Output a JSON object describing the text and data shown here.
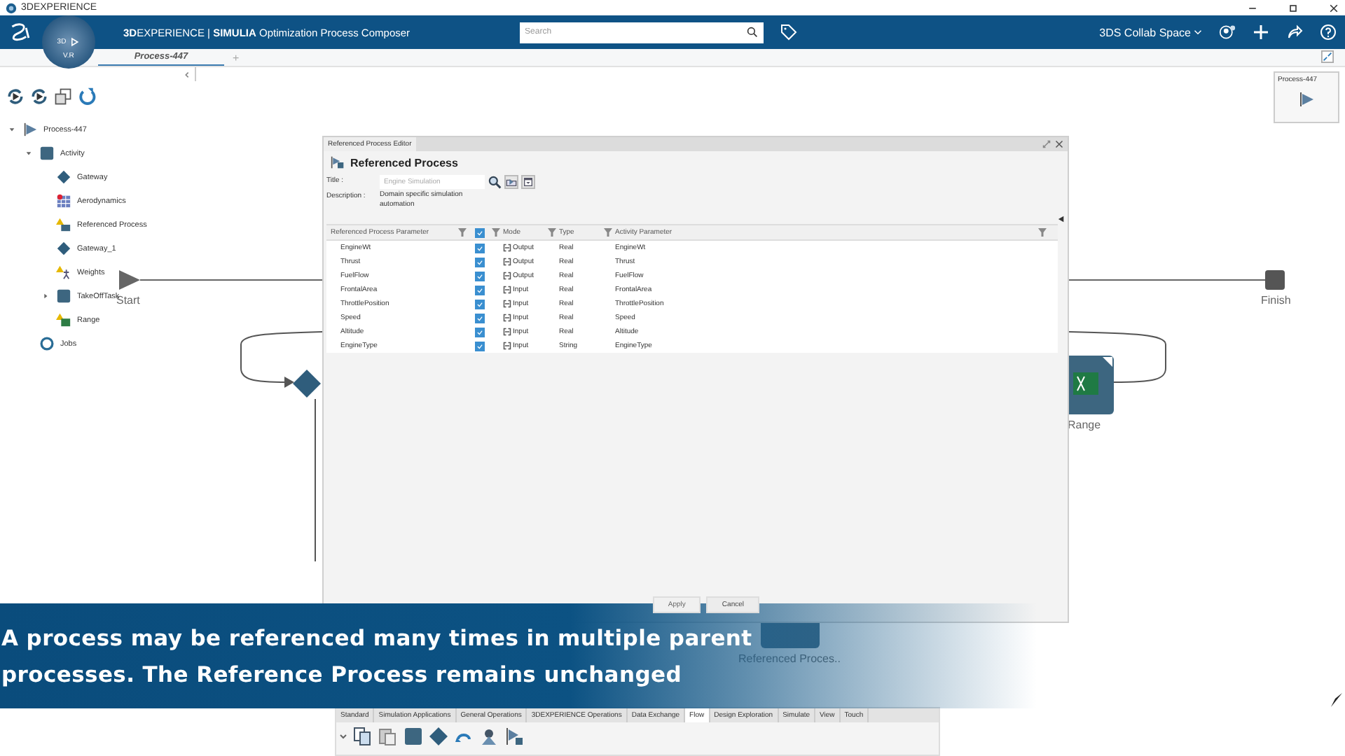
{
  "window": {
    "title": "3DEXPERIENCE"
  },
  "header": {
    "compass_labels": [
      "3D",
      "V.R"
    ],
    "brand": "**3D**EXPERIENCE | **SIMULIA** Optimization Process Composer",
    "search": {
      "placeholder": "Search"
    },
    "space": "3DS Collab Space"
  },
  "doc_tabs": [
    {
      "label": "Process-447",
      "selected": true
    }
  ],
  "new_tab": "+",
  "thumbnail": {
    "title": "Process-447"
  },
  "tree": [
    {
      "label": "Process-447",
      "kind": "process",
      "expanded": true,
      "children": [
        {
          "label": "Activity",
          "kind": "activity",
          "expanded": true,
          "children": [
            {
              "label": "Gateway",
              "kind": "gateway"
            },
            {
              "label": "Aerodynamics",
              "kind": "app"
            },
            {
              "label": "Referenced Process",
              "kind": "ref"
            },
            {
              "label": "Gateway_1",
              "kind": "gateway"
            },
            {
              "label": "Weights",
              "kind": "weights"
            },
            {
              "label": "TakeOffTask",
              "kind": "activity",
              "expanded": false
            },
            {
              "label": "Range",
              "kind": "excel"
            }
          ]
        },
        {
          "label": "Jobs",
          "kind": "jobs"
        }
      ]
    }
  ],
  "canvas": {
    "start": "Start",
    "finish": "Finish",
    "range": "Range",
    "ref_node": "Referenced Proces.."
  },
  "dialog": {
    "title": "Referenced Process Editor",
    "heading": "Referenced Process",
    "title_label": "Title :",
    "title_value": "Engine Simulation",
    "description_label": "Description :",
    "description": "Domain specific simulation automation",
    "columns": [
      "Referenced Process Parameter",
      "Mode",
      "Type",
      "Activity Parameter"
    ],
    "header_checked": true,
    "rows": [
      {
        "name": "EngineWt",
        "checked": true,
        "mode": "Output",
        "type": "Real",
        "activity": "EngineWt"
      },
      {
        "name": "Thrust",
        "checked": true,
        "mode": "Output",
        "type": "Real",
        "activity": "Thrust"
      },
      {
        "name": "FuelFlow",
        "checked": true,
        "mode": "Output",
        "type": "Real",
        "activity": "FuelFlow"
      },
      {
        "name": "FrontalArea",
        "checked": true,
        "mode": "Input",
        "type": "Real",
        "activity": "FrontalArea"
      },
      {
        "name": "ThrottlePosition",
        "checked": true,
        "mode": "Input",
        "type": "Real",
        "activity": "ThrottlePosition"
      },
      {
        "name": "Speed",
        "checked": true,
        "mode": "Input",
        "type": "Real",
        "activity": "Speed"
      },
      {
        "name": "Altitude",
        "checked": true,
        "mode": "Input",
        "type": "Real",
        "activity": "Altitude"
      },
      {
        "name": "EngineType",
        "checked": true,
        "mode": "Input",
        "type": "String",
        "activity": "EngineType"
      }
    ],
    "buttons": [
      {
        "label": "Apply",
        "disabled": true
      },
      {
        "label": "Cancel",
        "disabled": false
      }
    ]
  },
  "caption": [
    "A process may be referenced many times in multiple parent",
    "processes. The Reference Process remains unchanged"
  ],
  "ribbon_tabs": [
    {
      "label": "Standard",
      "selected": false
    },
    {
      "label": "Simulation Applications",
      "selected": false
    },
    {
      "label": "General Operations",
      "selected": false
    },
    {
      "label": "3DEXPERIENCE Operations",
      "selected": false
    },
    {
      "label": "Data Exchange",
      "selected": false
    },
    {
      "label": "Flow",
      "selected": true
    },
    {
      "label": "Design Exploration",
      "selected": false
    },
    {
      "label": "Simulate",
      "selected": false
    },
    {
      "label": "View",
      "selected": false
    },
    {
      "label": "Touch",
      "selected": false
    }
  ]
}
